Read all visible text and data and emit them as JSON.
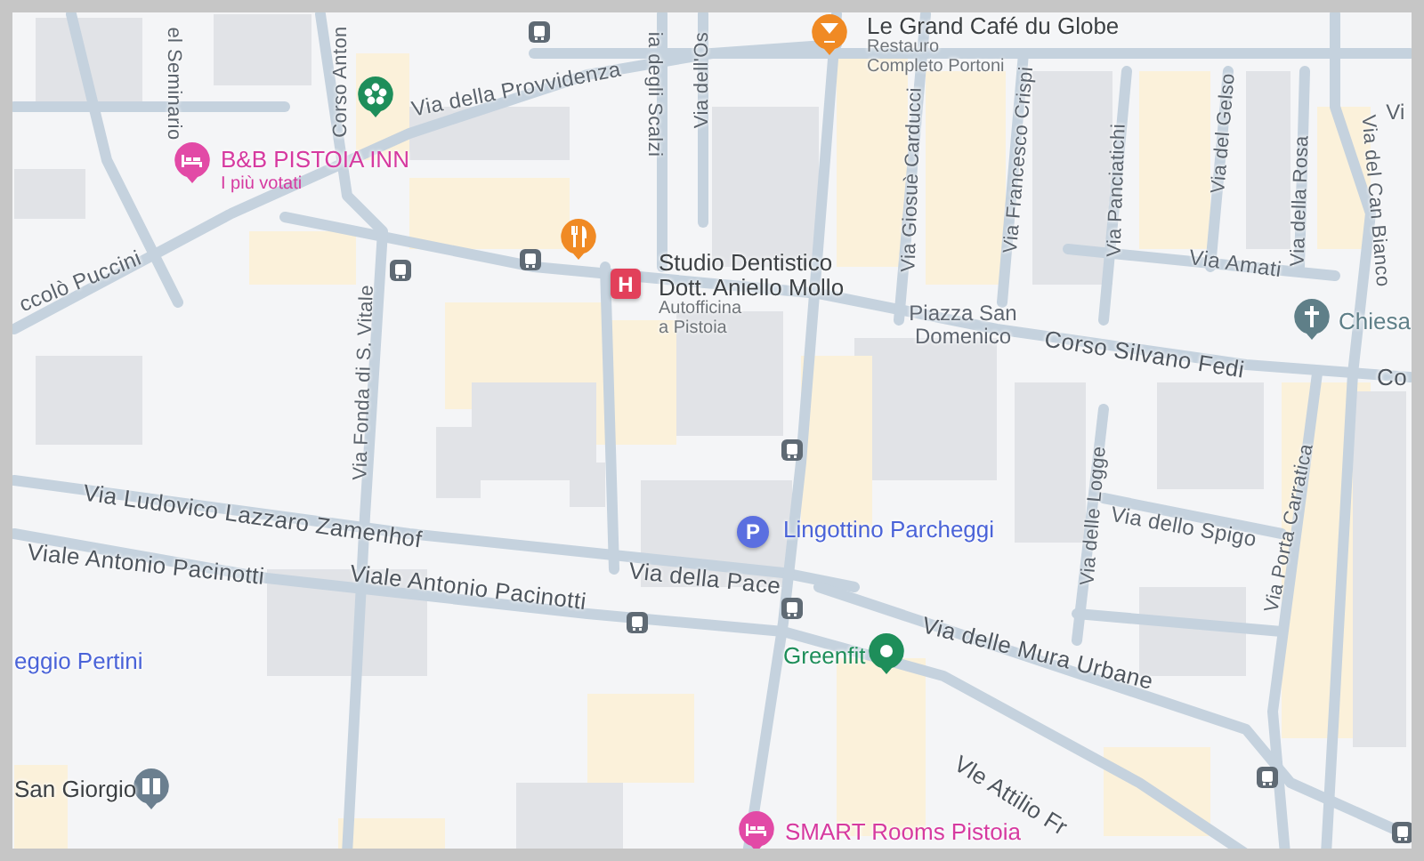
{
  "map": {
    "places": [
      {
        "kind": "bar",
        "name": "Le Grand Café du Globe"
      },
      {
        "kind": "label",
        "lines": [
          "Restauro",
          "Completo Portoni"
        ]
      },
      {
        "kind": "hotel",
        "name": "B&B PISTOIA INN",
        "subtitle": "I più votati"
      },
      {
        "kind": "garden"
      },
      {
        "kind": "restaurant"
      },
      {
        "kind": "hospital",
        "marker": "H",
        "lines": [
          "Studio Dentistico",
          "Dott. Aniello Mollo"
        ]
      },
      {
        "kind": "label",
        "lines": [
          "Autofficina",
          "a Pistoia"
        ]
      },
      {
        "kind": "square",
        "lines": [
          "Piazza San",
          "Domenico"
        ]
      },
      {
        "kind": "church",
        "name": "Chiesa"
      },
      {
        "kind": "parking",
        "marker": "P",
        "name": "Lingottino Parcheggi"
      },
      {
        "kind": "gym",
        "name": "Greenfit"
      },
      {
        "kind": "parking_label",
        "name": "eggio Pertini"
      },
      {
        "kind": "library",
        "name": "San Giorgio"
      },
      {
        "kind": "hotel",
        "name": "SMART Rooms Pistoia"
      }
    ],
    "streets": [
      {
        "name": "el Seminario"
      },
      {
        "name": "Corso Anton"
      },
      {
        "name": "Via della Provvidenza"
      },
      {
        "name": "ccolò Puccini"
      },
      {
        "name": "ia degli Scalzi"
      },
      {
        "name": "Via dell'Os"
      },
      {
        "name": "Via Giosuè Carducci"
      },
      {
        "name": "Via Francesco Crispi"
      },
      {
        "name": "Via Panciatichi"
      },
      {
        "name": "Via del Gelso"
      },
      {
        "name": "Via della Rosa"
      },
      {
        "name": "Via del Can Bianco"
      },
      {
        "name": "Vi"
      },
      {
        "name": "Via Amati"
      },
      {
        "name": "Corso Silvano Fedi"
      },
      {
        "name": "Co"
      },
      {
        "name": "Via Fonda di S. Vitale"
      },
      {
        "name": "Via Ludovico Lazzaro Zamenhof"
      },
      {
        "name": "Viale Antonio Pacinotti"
      },
      {
        "name": "Viale Antonio Pacinotti"
      },
      {
        "name": "Via della Pace"
      },
      {
        "name": "Via delle Mura Urbane"
      },
      {
        "name": "Via delle Logge"
      },
      {
        "name": "Via dello Spigo"
      },
      {
        "name": "Via Porta Carratica"
      },
      {
        "name": "Vle Attilio Fr"
      }
    ]
  }
}
